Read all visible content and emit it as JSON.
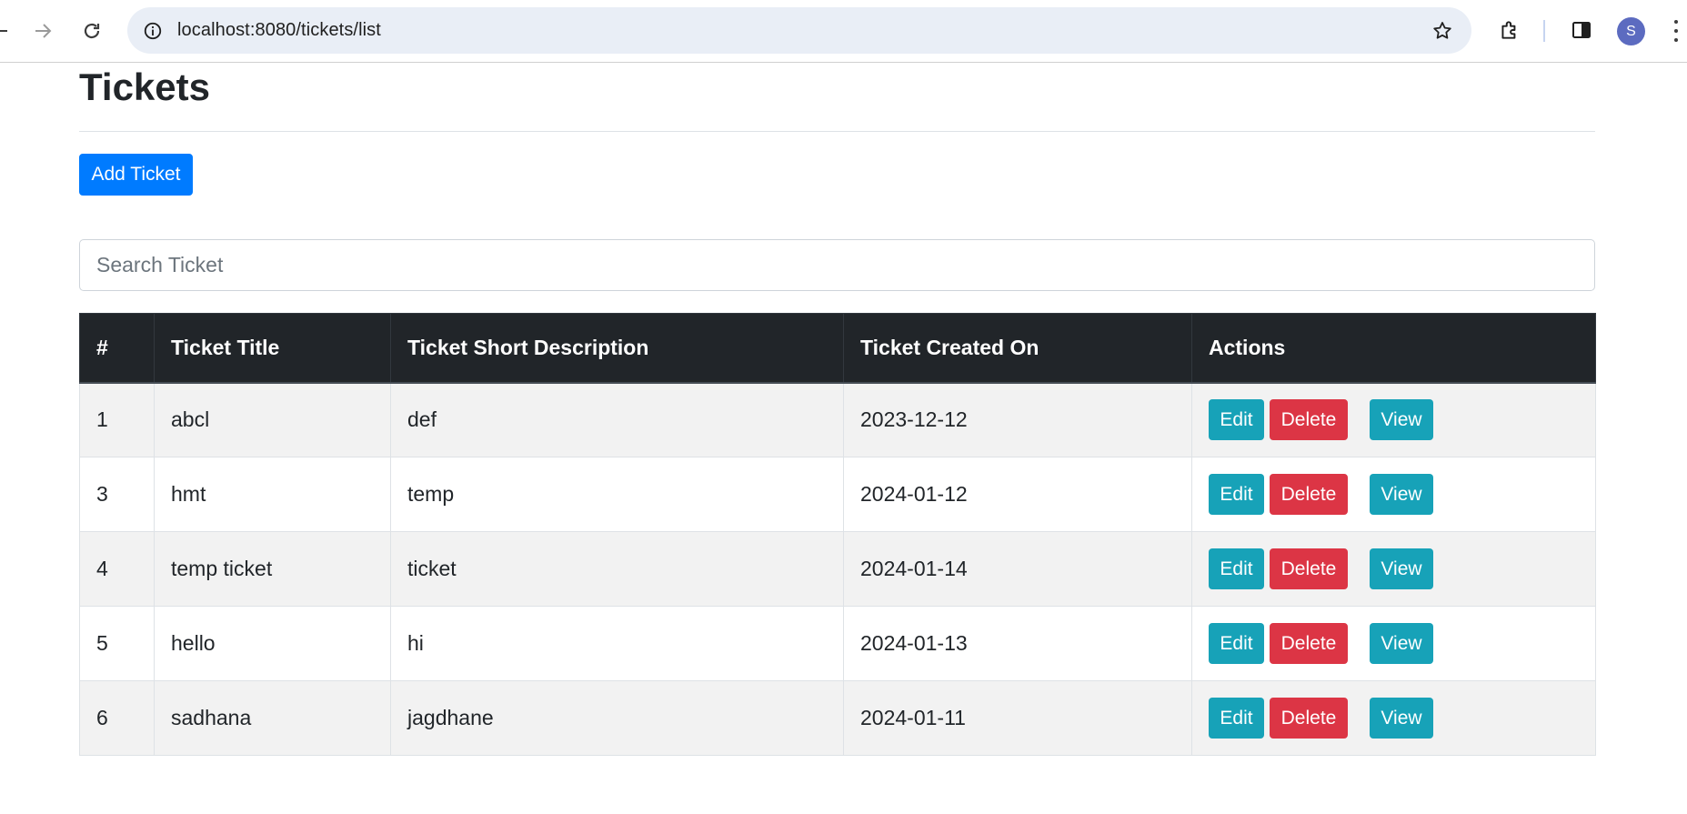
{
  "browser": {
    "url": "localhost:8080/tickets/list",
    "profile_initial": "S",
    "icons": [
      "back-icon",
      "forward-icon",
      "reload-icon",
      "site-info-icon",
      "bookmark-star-icon",
      "extensions-icon",
      "side-panel-icon",
      "menu-kebab-icon"
    ]
  },
  "page": {
    "title": "Tickets",
    "add_button_label": "Add Ticket",
    "search_placeholder": "Search Ticket"
  },
  "table": {
    "headers": [
      "#",
      "Ticket Title",
      "Ticket Short Description",
      "Ticket Created On",
      "Actions"
    ],
    "rows": [
      {
        "id": "1",
        "title": "abcl",
        "description": "def",
        "created_on": "2023-12-12"
      },
      {
        "id": "3",
        "title": "hmt",
        "description": "temp",
        "created_on": "2024-01-12"
      },
      {
        "id": "4",
        "title": "temp ticket",
        "description": "ticket",
        "created_on": "2024-01-14"
      },
      {
        "id": "5",
        "title": "hello",
        "description": "hi",
        "created_on": "2024-01-13"
      },
      {
        "id": "6",
        "title": "sadhana",
        "description": "jagdhane",
        "created_on": "2024-01-11"
      }
    ],
    "action_labels": {
      "edit": "Edit",
      "delete": "Delete",
      "view": "View"
    }
  },
  "colors": {
    "primary": "#007bff",
    "info": "#17a2b8",
    "danger": "#dc3545",
    "table_header": "#212529"
  }
}
